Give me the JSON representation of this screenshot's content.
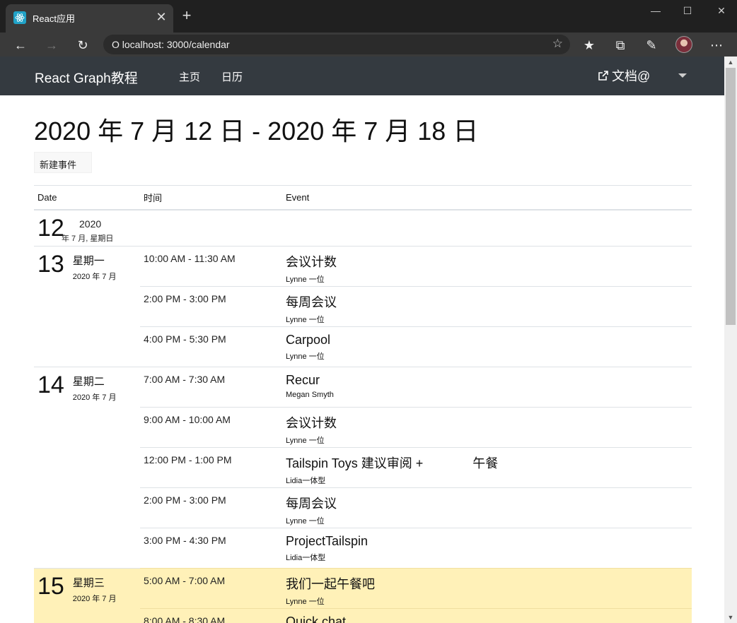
{
  "browser": {
    "tab_title": "React应用",
    "address": "O localhost: 3000/calendar",
    "tab_close_glyph": "✕",
    "new_tab_glyph": "+"
  },
  "app": {
    "brand": "React Graph教程",
    "nav_home": "主页",
    "nav_calendar": "日历",
    "docs_label": "文档@"
  },
  "page": {
    "title": "2020 年 7 月 12 日 - 2020 年 7 月 18 日",
    "new_event_button": "新建事件"
  },
  "table": {
    "headers": {
      "date": "Date",
      "time": "时间",
      "event": "Event"
    }
  },
  "days": [
    {
      "num": "12",
      "name": "2020",
      "month": "年 7 月, 星期日"
    },
    {
      "num": "13",
      "name": "星期一",
      "month": "2020 年 7 月"
    },
    {
      "num": "14",
      "name": "星期二",
      "month": "2020 年 7 月"
    },
    {
      "num": "15",
      "name": "星期三",
      "month": "2020 年 7 月"
    }
  ],
  "events": [
    {
      "time": "10:00 AM - 11:30 AM",
      "subject": "会议计数",
      "organizer": "Lynne 一位"
    },
    {
      "time": "2:00 PM - 3:00 PM",
      "subject": "每周会议",
      "organizer": "Lynne 一位"
    },
    {
      "time": "4:00 PM - 5:30 PM",
      "subject": "Carpool",
      "organizer": "Lynne 一位"
    },
    {
      "time": "7:00 AM - 7:30 AM",
      "subject": "Recur",
      "organizer": "Megan Smyth"
    },
    {
      "time": "9:00 AM - 10:00 AM",
      "subject": "会议计数",
      "organizer": "Lynne 一位"
    },
    {
      "time": "12:00 PM - 1:00 PM",
      "subject": "Tailspin Toys 建议审阅 +              午餐",
      "organizer": "Lidia一体型"
    },
    {
      "time": "2:00 PM - 3:00 PM",
      "subject": "每周会议",
      "organizer": "Lynne 一位"
    },
    {
      "time": "3:00 PM - 4:30 PM",
      "subject": "ProjectTailspin",
      "organizer": "Lidia一体型"
    },
    {
      "time": "5:00 AM - 7:00 AM",
      "subject": "我们一起午餐吧",
      "organizer": "Lynne 一位"
    },
    {
      "time": "8:00 AM - 8:30 AM",
      "subject": "Quick chat",
      "organizer": ""
    }
  ],
  "colors": {
    "appbar": "#343a40",
    "today_highlight": "#fff1b8"
  }
}
